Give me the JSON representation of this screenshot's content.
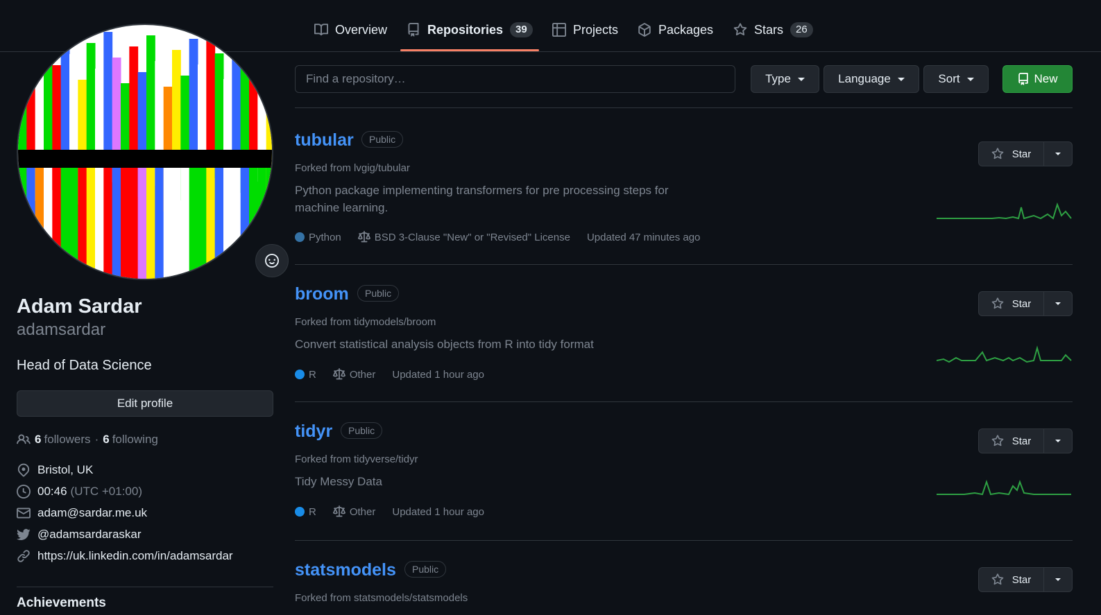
{
  "nav": {
    "tabs": [
      {
        "label": "Overview"
      },
      {
        "label": "Repositories",
        "count": "39"
      },
      {
        "label": "Projects"
      },
      {
        "label": "Packages"
      },
      {
        "label": "Stars",
        "count": "26"
      }
    ]
  },
  "profile": {
    "name": "Adam Sardar",
    "login": "adamsardar",
    "bio": "Head of Data Science",
    "edit_label": "Edit profile",
    "followers_count": "6",
    "followers_label": "followers",
    "separator": "·",
    "following_count": "6",
    "following_label": "following",
    "location": "Bristol, UK",
    "local_time": "00:46",
    "timezone": "(UTC +01:00)",
    "email": "adam@sardar.me.uk",
    "twitter": "@adamsardaraskar",
    "website": "https://uk.linkedin.com/in/adamsardar",
    "achievements_label": "Achievements"
  },
  "filters": {
    "search_placeholder": "Find a repository…",
    "type_label": "Type",
    "language_label": "Language",
    "sort_label": "Sort",
    "new_label": "New"
  },
  "repos": [
    {
      "name": "tubular",
      "visibility": "Public",
      "forked_from": "Forked from lvgig/tubular",
      "description": "Python package implementing transformers for pre processing steps for machine learning.",
      "language": "Python",
      "language_color": "#3572A5",
      "license": "BSD 3-Clause \"New\" or \"Revised\" License",
      "updated": "Updated 47 minutes ago",
      "star_label": "Star"
    },
    {
      "name": "broom",
      "visibility": "Public",
      "forked_from": "Forked from tidymodels/broom",
      "description": "Convert statistical analysis objects from R into tidy format",
      "language": "R",
      "language_color": "#198CE7",
      "license": "Other",
      "updated": "Updated 1 hour ago",
      "star_label": "Star"
    },
    {
      "name": "tidyr",
      "visibility": "Public",
      "forked_from": "Forked from tidyverse/tidyr",
      "description": "Tidy Messy Data",
      "language": "R",
      "language_color": "#198CE7",
      "license": "Other",
      "updated": "Updated 1 hour ago",
      "star_label": "Star"
    },
    {
      "name": "statsmodels",
      "visibility": "Public",
      "forked_from": "Forked from statsmodels/statsmodels",
      "star_label": "Star"
    }
  ],
  "colors": {
    "background": "#0d1117",
    "link": "#4493f8",
    "accent_underline": "#f78166",
    "new_button": "#238636",
    "sparkline": "#2ea043"
  }
}
